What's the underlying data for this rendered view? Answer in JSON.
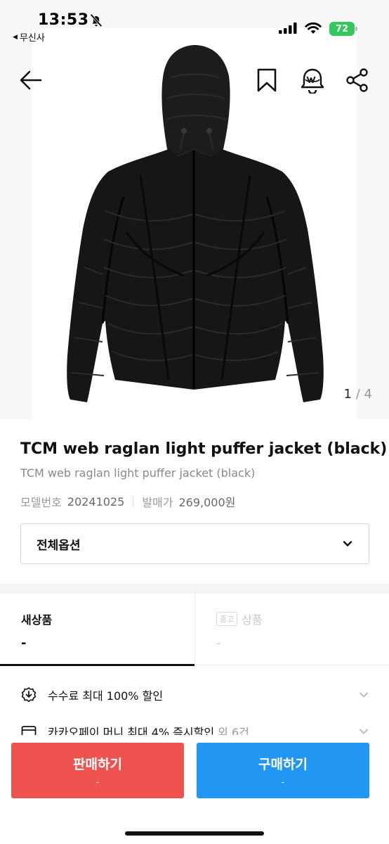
{
  "status_bar": {
    "time": "13:53",
    "back_app": "무신사",
    "battery": "72"
  },
  "gallery": {
    "current": "1",
    "separator": "/",
    "total": "4"
  },
  "product": {
    "title": "TCM web raglan light puffer jacket (black)",
    "subtitle": "TCM web raglan light puffer jacket (black)",
    "model_label": "모델번호",
    "model_value": "20241025",
    "release_label": "발매가",
    "release_value": "269,000원"
  },
  "option": {
    "label": "전체옵션"
  },
  "tabs": {
    "new": {
      "label": "새상품",
      "price": "-"
    },
    "used": {
      "badge": "중고",
      "label": "상품",
      "price": "-"
    }
  },
  "benefits": [
    {
      "text": "수수료 최대 100% 할인",
      "icon": "discount-icon"
    },
    {
      "text": "카카오페이 머니 최대 4% 즉시할인",
      "extra": " 외 6건",
      "icon": "card-icon"
    }
  ],
  "actions": {
    "sell": {
      "label": "판매하기",
      "sub": "-"
    },
    "buy": {
      "label": "구매하기",
      "sub": "-"
    }
  },
  "colors": {
    "sell": "#ef5350",
    "buy": "#2196f3",
    "battery": "#34c759"
  }
}
